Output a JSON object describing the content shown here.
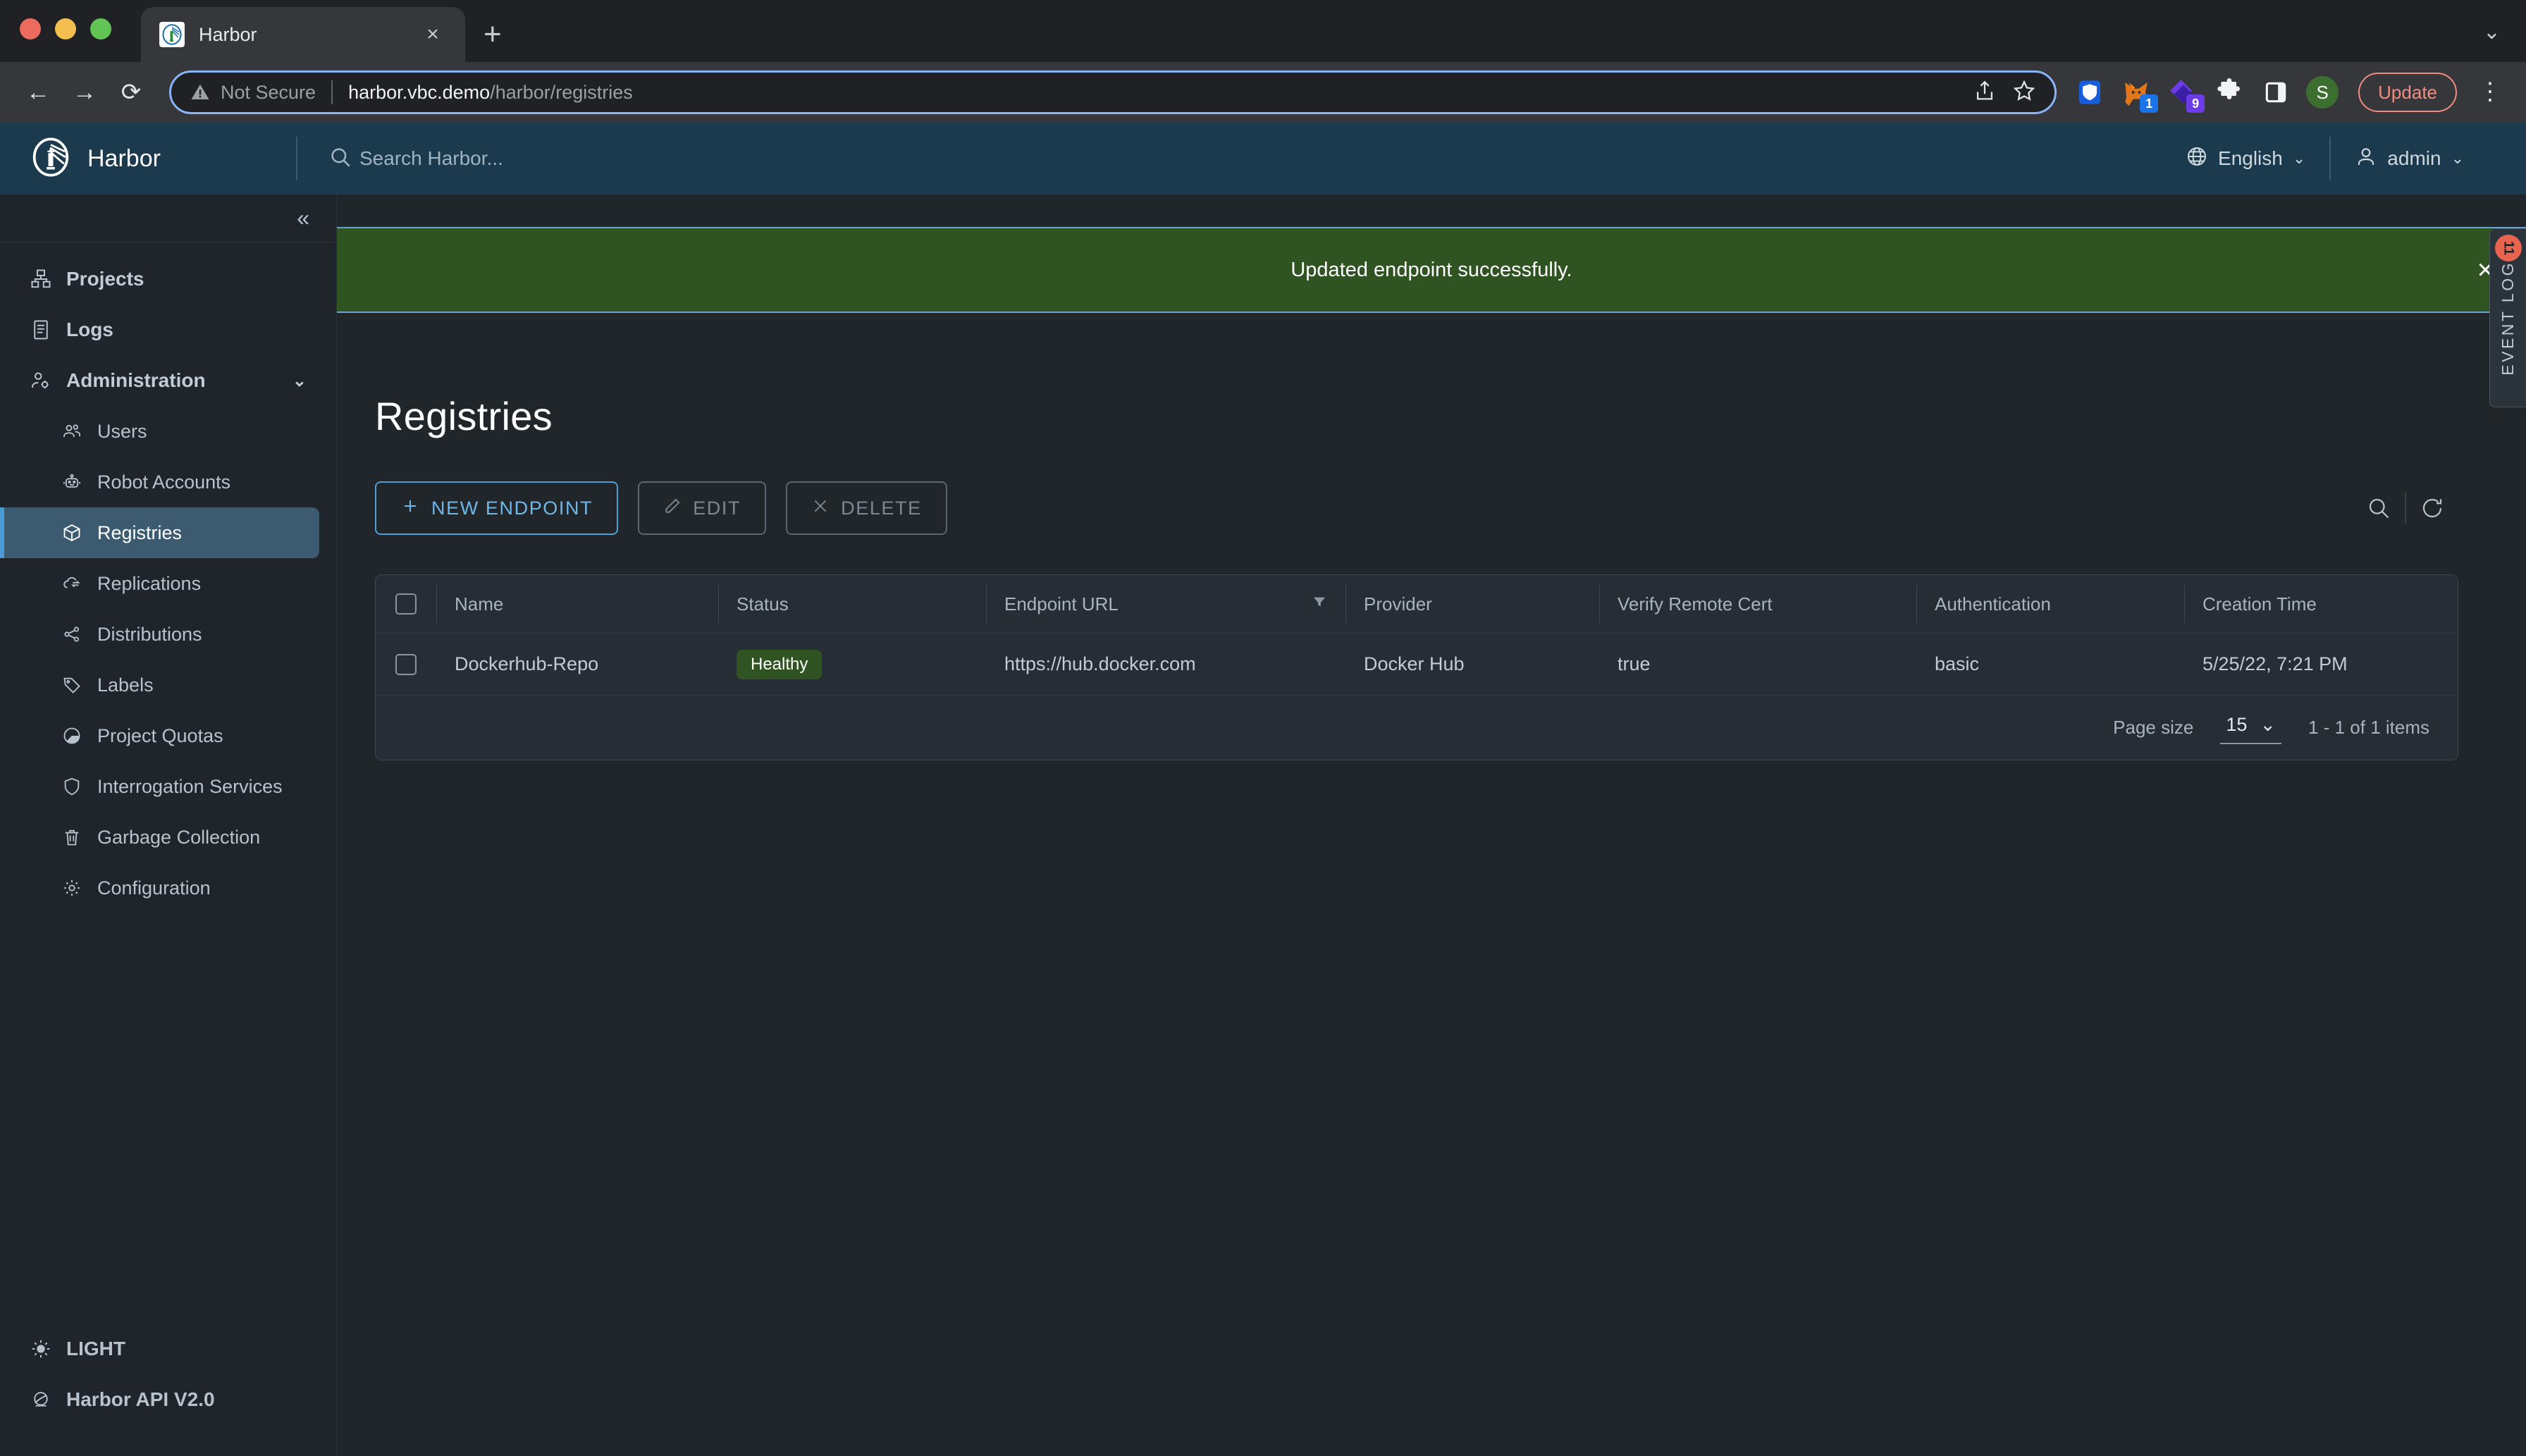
{
  "browser": {
    "tab": {
      "title": "Harbor",
      "favicon": "harbor-favicon",
      "close_label": "×"
    },
    "new_tab_label": "+",
    "window_chevron": "⌄",
    "nav": {
      "back": "←",
      "forward": "→",
      "reload": "⟳"
    },
    "omnibox": {
      "security_label": "Not Secure",
      "url_host": "harbor.vbc.demo",
      "url_path": "/harbor/registries",
      "share_icon": "share-icon",
      "bookmark_icon": "star-icon"
    },
    "extensions": [
      {
        "name": "bitwarden-extension-icon",
        "badge": "",
        "badge_color": "#175ddc"
      },
      {
        "name": "metamask-extension-icon",
        "badge": "1",
        "badge_color": "#1a73e8"
      },
      {
        "name": "phantom-extension-icon",
        "badge": "9",
        "badge_color": "#6c3ce9"
      },
      {
        "name": "extensions-puzzle-icon",
        "badge": "",
        "badge_color": ""
      },
      {
        "name": "side-panel-icon",
        "badge": "",
        "badge_color": ""
      }
    ],
    "profile_initial": "S",
    "update_label": "Update",
    "menu_icon": "kebab-menu-icon"
  },
  "header": {
    "logo": "harbor-lighthouse-logo",
    "product_name": "Harbor",
    "search_placeholder": "Search Harbor...",
    "language": "English",
    "user": "admin"
  },
  "sidebar": {
    "collapse_icon": "«",
    "items": [
      {
        "label": "Projects",
        "icon": "projects-icon",
        "level": "top"
      },
      {
        "label": "Logs",
        "icon": "logs-icon",
        "level": "top"
      },
      {
        "label": "Administration",
        "icon": "administration-icon",
        "level": "top",
        "expanded": true,
        "caret": "⌄"
      },
      {
        "label": "Users",
        "icon": "users-icon",
        "level": "sub"
      },
      {
        "label": "Robot Accounts",
        "icon": "robot-icon",
        "level": "sub"
      },
      {
        "label": "Registries",
        "icon": "registries-cube-icon",
        "level": "sub",
        "active": true
      },
      {
        "label": "Replications",
        "icon": "replications-cloud-icon",
        "level": "sub"
      },
      {
        "label": "Distributions",
        "icon": "distributions-share-icon",
        "level": "sub"
      },
      {
        "label": "Labels",
        "icon": "labels-tag-icon",
        "level": "sub"
      },
      {
        "label": "Project Quotas",
        "icon": "quotas-pie-icon",
        "level": "sub"
      },
      {
        "label": "Interrogation Services",
        "icon": "shield-icon",
        "level": "sub"
      },
      {
        "label": "Garbage Collection",
        "icon": "trash-icon",
        "level": "sub"
      },
      {
        "label": "Configuration",
        "icon": "gear-icon",
        "level": "sub"
      }
    ],
    "footer": [
      {
        "label": "LIGHT",
        "icon": "sun-icon"
      },
      {
        "label": "Harbor API V2.0",
        "icon": "api-icon"
      }
    ]
  },
  "alert": {
    "message": "Updated endpoint successfully.",
    "close_icon": "×",
    "bg_color": "#2f5422",
    "border_color": "#67a3d4"
  },
  "event_log": {
    "label": "EVENT LOG",
    "count": "11",
    "badge_color": "#e8644f"
  },
  "page": {
    "title": "Registries",
    "actions": [
      {
        "label": "NEW ENDPOINT",
        "icon": "plus-icon",
        "state": "enabled"
      },
      {
        "label": "EDIT",
        "icon": "pencil-icon",
        "state": "disabled"
      },
      {
        "label": "DELETE",
        "icon": "x-icon",
        "state": "disabled"
      }
    ],
    "tools": [
      {
        "name": "search-icon"
      },
      {
        "name": "refresh-icon"
      }
    ]
  },
  "table": {
    "columns": [
      {
        "label": "Name"
      },
      {
        "label": "Status"
      },
      {
        "label": "Endpoint URL",
        "filter": true
      },
      {
        "label": "Provider"
      },
      {
        "label": "Verify Remote Cert"
      },
      {
        "label": "Authentication"
      },
      {
        "label": "Creation Time"
      }
    ],
    "rows": [
      {
        "name": "Dockerhub-Repo",
        "status": "Healthy",
        "status_color": "#2f5422",
        "endpoint_url": "https://hub.docker.com",
        "provider": "Docker Hub",
        "verify_remote_cert": "true",
        "authentication": "basic",
        "creation_time": "5/25/22, 7:21 PM"
      }
    ],
    "footer": {
      "page_size_label": "Page size",
      "page_size_value": "15",
      "page_size_caret": "⌄",
      "items_range": "1 - 1 of 1 items"
    }
  }
}
